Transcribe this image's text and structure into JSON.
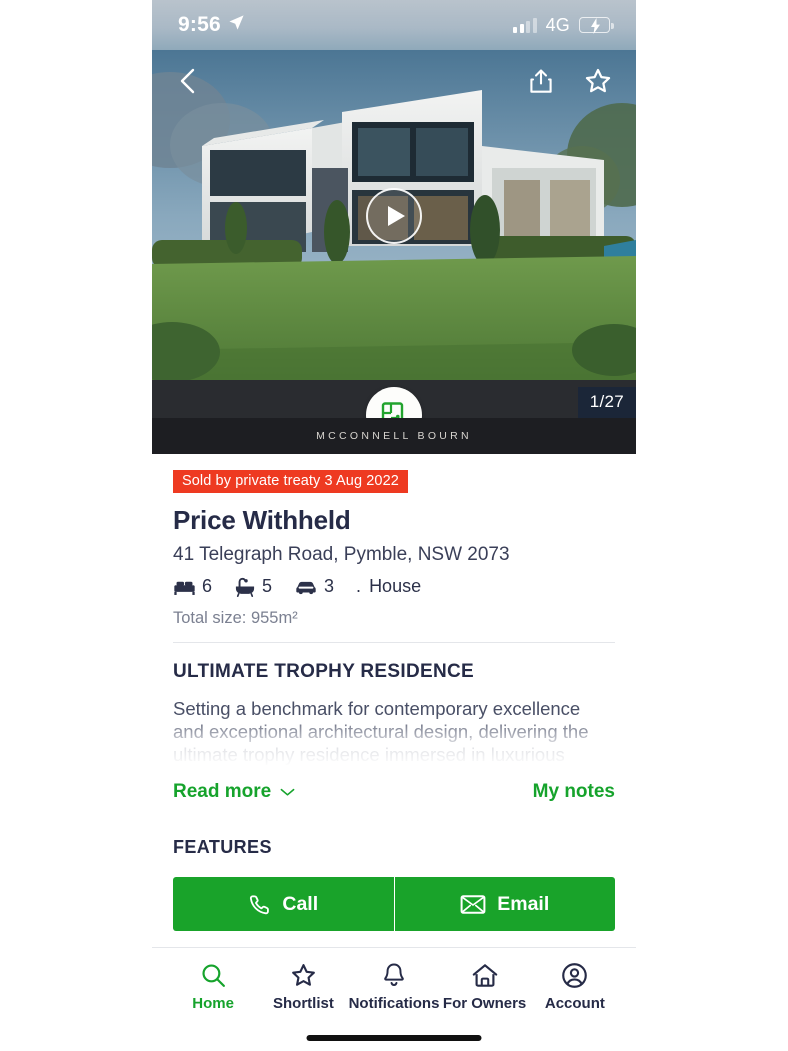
{
  "status_bar": {
    "time": "9:56",
    "location_icon": "location-arrow-icon",
    "network": "4G",
    "signal_icon": "signal-bars-icon",
    "battery_icon": "battery-charging-icon"
  },
  "gallery": {
    "back_icon": "back-chevron-icon",
    "share_icon": "share-icon",
    "shortlist_icon": "star-outline-icon",
    "play_icon": "play-icon",
    "floorplan_icon": "floorplan-icon",
    "counter": "1/27",
    "agency_name": "MCCONNELL BOURN"
  },
  "summary": {
    "status_badge": "Sold by private treaty 3 Aug 2022",
    "price": "Price Withheld",
    "address": "41 Telegraph Road, Pymble, NSW 2073",
    "bedrooms": "6",
    "bathrooms": "5",
    "parking": "3",
    "separator": ".",
    "property_type": "House",
    "total_size": "Total size: 955m²",
    "bed_icon": "bed-icon",
    "bath_icon": "bath-icon",
    "car_icon": "car-icon"
  },
  "description": {
    "heading": "ULTIMATE TROPHY RESIDENCE",
    "body": "Setting a benchmark for contemporary excellence and exceptional architectural design, delivering the ultimate trophy residence immersed in luxurious",
    "read_more": "Read more",
    "read_more_icon": "chevron-down-icon",
    "my_notes": "My notes"
  },
  "features": {
    "heading": "FEATURES"
  },
  "cta": {
    "call_label": "Call",
    "call_icon": "phone-icon",
    "email_label": "Email",
    "email_icon": "envelope-icon"
  },
  "tabbar": {
    "items": [
      {
        "label": "Home",
        "icon": "search-icon",
        "active": true
      },
      {
        "label": "Shortlist",
        "icon": "star-icon",
        "active": false
      },
      {
        "label": "Notifications",
        "icon": "bell-icon",
        "active": false
      },
      {
        "label": "For Owners",
        "icon": "house-icon",
        "active": false
      },
      {
        "label": "Account",
        "icon": "account-circle-icon",
        "active": false
      }
    ]
  },
  "colors": {
    "brand_green": "#16a32c",
    "sold_red": "#ee3a21",
    "navy_text": "#262b47",
    "agency_bar": "#1d1e22"
  }
}
